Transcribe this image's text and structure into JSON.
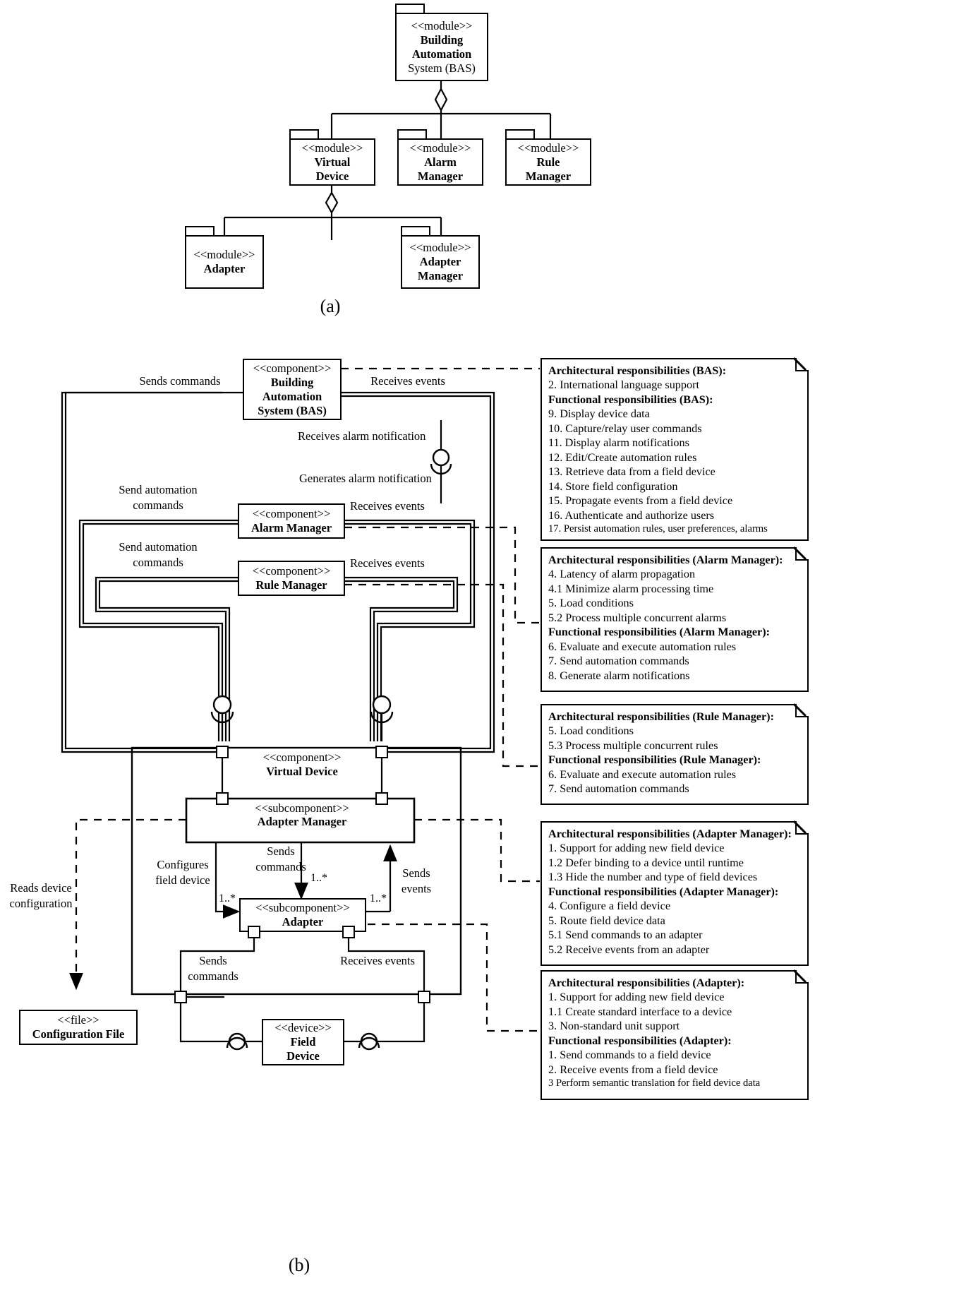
{
  "figure": {
    "caption_a": "(a)",
    "caption_b": "(b)"
  },
  "module_diagram": {
    "stereotype": "<<module>>",
    "nodes": [
      {
        "id": "bas",
        "stereotype": "<<module>>",
        "line1": "Building",
        "line2": "Automation",
        "line3": "System (BAS)"
      },
      {
        "id": "virtual-device",
        "stereotype": "<<module>>",
        "line1": "Virtual",
        "line2": "Device",
        "line3": ""
      },
      {
        "id": "alarm-manager",
        "stereotype": "<<module>>",
        "line1": "Alarm",
        "line2": "Manager",
        "line3": ""
      },
      {
        "id": "rule-manager",
        "stereotype": "<<module>>",
        "line1": "Rule",
        "line2": "Manager",
        "line3": ""
      },
      {
        "id": "adapter",
        "stereotype": "<<module>>",
        "line1": "Adapter",
        "line2": "",
        "line3": ""
      },
      {
        "id": "adapter-manager",
        "stereotype": "<<module>>",
        "line1": "Adapter",
        "line2": "Manager",
        "line3": ""
      }
    ]
  },
  "component_diagram": {
    "stereotype_component": "<<component>>",
    "stereotype_subcomponent": "<<subcomponent>>",
    "stereotype_device": "<<device>>",
    "stereotype_file": "<<file>>",
    "nodes": {
      "bas": {
        "stereotype": "<<component>>",
        "line1": "Building",
        "line2": "Automation",
        "line3": "System (BAS)"
      },
      "alarm_manager": {
        "stereotype": "<<component>>",
        "name": "Alarm Manager"
      },
      "rule_manager": {
        "stereotype": "<<component>>",
        "name": "Rule Manager"
      },
      "virtual_device": {
        "stereotype": "<<component>>",
        "name": "Virtual Device"
      },
      "adapter_manager": {
        "stereotype": "<<subcomponent>>",
        "name": "Adapter Manager"
      },
      "adapter": {
        "stereotype": "<<subcomponent>>",
        "name": "Adapter"
      },
      "field_device": {
        "stereotype": "<<device>>",
        "line1": "Field",
        "line2": "Device"
      },
      "configuration_file": {
        "stereotype": "<<file>>",
        "name": "Configuration File"
      }
    },
    "edge_labels": {
      "sends_commands_bas": "Sends commands",
      "receives_events_bas": "Receives events",
      "receives_alarm_notification": "Receives alarm notification",
      "generates_alarm_notification": "Generates alarm notification",
      "send_automation_commands_alarm_1": "Send automation",
      "send_automation_commands_alarm_2": "commands",
      "receives_events_alarm": "Receives events",
      "send_automation_commands_rule_1": "Send automation",
      "send_automation_commands_rule_2": "commands",
      "receives_events_rule": "Receives events",
      "configures_field_device_1": "Configures",
      "configures_field_device_2": "field device",
      "sends_commands_am_1": "Sends",
      "sends_commands_am_2": "commands",
      "sends_events_am_1": "Sends",
      "sends_events_am_2": "events",
      "sends_commands_adapter_1": "Sends",
      "sends_commands_adapter_2": "commands",
      "receives_events_adapter": "Receives events",
      "reads_device_configuration_1": "Reads device",
      "reads_device_configuration_2": "configuration",
      "mult_1": "1..*",
      "mult_2": "1..*",
      "mult_3": "1..*"
    },
    "notes": [
      {
        "id": "note-bas",
        "lines": [
          {
            "text": "Architectural responsibilities (BAS):",
            "bold": true
          },
          {
            "text": "2. International language support",
            "bold": false
          },
          {
            "text": "Functional responsibilities (BAS):",
            "bold": true
          },
          {
            "text": "9. Display device data",
            "bold": false
          },
          {
            "text": "10. Capture/relay user commands",
            "bold": false
          },
          {
            "text": "11. Display alarm notifications",
            "bold": false
          },
          {
            "text": "12. Edit/Create automation rules",
            "bold": false
          },
          {
            "text": "13. Retrieve data from a field device",
            "bold": false
          },
          {
            "text": "14. Store field configuration",
            "bold": false
          },
          {
            "text": "15. Propagate events from a field device",
            "bold": false
          },
          {
            "text": "16. Authenticate and authorize users",
            "bold": false
          },
          {
            "text": "17. Persist automation rules, user preferences, alarms",
            "bold": false,
            "small": true
          }
        ]
      },
      {
        "id": "note-alarm-manager",
        "lines": [
          {
            "text": "Architectural responsibilities (Alarm Manager):",
            "bold": true
          },
          {
            "text": "4. Latency of alarm propagation",
            "bold": false
          },
          {
            "text": "4.1 Minimize alarm processing time",
            "bold": false
          },
          {
            "text": "5. Load conditions",
            "bold": false
          },
          {
            "text": "5.2 Process multiple concurrent alarms",
            "bold": false
          },
          {
            "text": "Functional responsibilities (Alarm Manager):",
            "bold": true
          },
          {
            "text": "6. Evaluate and execute automation rules",
            "bold": false
          },
          {
            "text": "7. Send automation commands",
            "bold": false
          },
          {
            "text": "8. Generate alarm notifications",
            "bold": false
          }
        ]
      },
      {
        "id": "note-rule-manager",
        "lines": [
          {
            "text": "Architectural responsibilities (Rule Manager):",
            "bold": true
          },
          {
            "text": "5. Load conditions",
            "bold": false
          },
          {
            "text": "5.3 Process multiple concurrent rules",
            "bold": false
          },
          {
            "text": "Functional responsibilities (Rule Manager):",
            "bold": true
          },
          {
            "text": "6. Evaluate and execute automation rules",
            "bold": false
          },
          {
            "text": "7. Send automation commands",
            "bold": false
          }
        ]
      },
      {
        "id": "note-adapter-manager",
        "lines": [
          {
            "text": "Architectural responsibilities (Adapter Manager):",
            "bold": true
          },
          {
            "text": "1. Support for adding new field device",
            "bold": false
          },
          {
            "text": "1.2 Defer binding to a device until runtime",
            "bold": false
          },
          {
            "text": "1.3 Hide the number and type of field devices",
            "bold": false
          },
          {
            "text": "Functional responsibilities (Adapter Manager):",
            "bold": true
          },
          {
            "text": "4. Configure a field device",
            "bold": false
          },
          {
            "text": "5. Route field device data",
            "bold": false
          },
          {
            "text": "5.1 Send commands to an adapter",
            "bold": false
          },
          {
            "text": "5.2 Receive events from an adapter",
            "bold": false
          }
        ]
      },
      {
        "id": "note-adapter",
        "lines": [
          {
            "text": "Architectural responsibilities (Adapter):",
            "bold": true
          },
          {
            "text": "1. Support for adding new field device",
            "bold": false
          },
          {
            "text": "1.1 Create standard interface to a device",
            "bold": false
          },
          {
            "text": "3. Non-standard unit support",
            "bold": false
          },
          {
            "text": "Functional responsibilities (Adapter):",
            "bold": true
          },
          {
            "text": "1. Send commands to a field device",
            "bold": false
          },
          {
            "text": "2. Receive events from a field device",
            "bold": false
          },
          {
            "text": "3 Perform semantic translation for field device data",
            "bold": false,
            "small": true
          }
        ]
      }
    ]
  },
  "colors": {
    "line": "#000000",
    "background": "#ffffff"
  }
}
